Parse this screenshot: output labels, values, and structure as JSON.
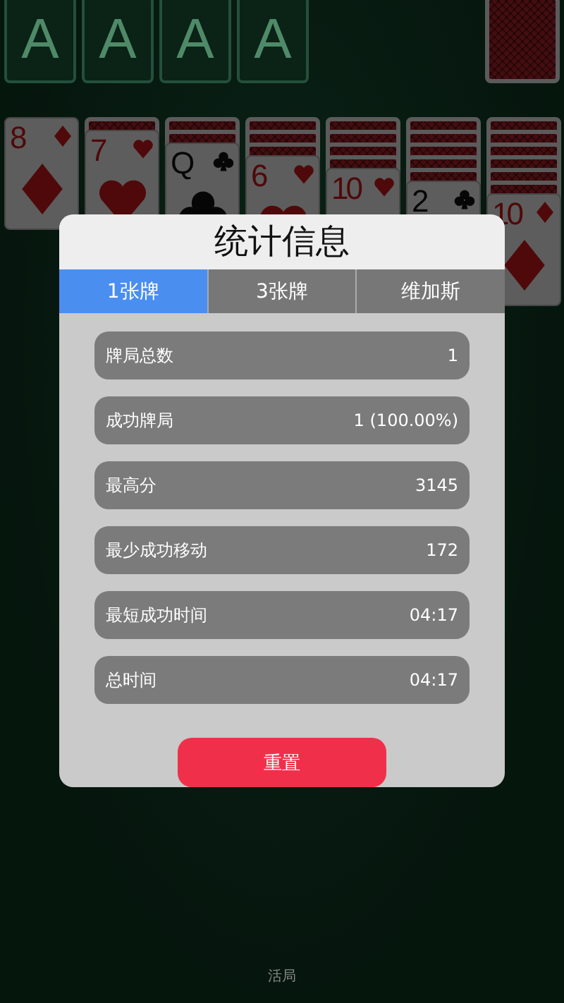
{
  "foundations": [
    {
      "label": "A"
    },
    {
      "label": "A"
    },
    {
      "label": "A"
    },
    {
      "label": "A"
    }
  ],
  "stock": {
    "kind": "card-back"
  },
  "tableau": [
    {
      "cards": [
        {
          "kind": "diamond",
          "rank": "8"
        }
      ]
    },
    {
      "cards": [
        {
          "kind": "back"
        },
        {
          "kind": "heart",
          "rank": "7"
        }
      ]
    },
    {
      "cards": [
        {
          "kind": "back"
        },
        {
          "kind": "back"
        },
        {
          "kind": "club",
          "rank": "Q"
        }
      ]
    },
    {
      "cards": [
        {
          "kind": "back"
        },
        {
          "kind": "back"
        },
        {
          "kind": "back"
        },
        {
          "kind": "heart",
          "rank": "6"
        }
      ]
    },
    {
      "cards": [
        {
          "kind": "back"
        },
        {
          "kind": "back"
        },
        {
          "kind": "back"
        },
        {
          "kind": "back"
        },
        {
          "kind": "heart",
          "rank": "10"
        }
      ]
    },
    {
      "cards": [
        {
          "kind": "back"
        },
        {
          "kind": "back"
        },
        {
          "kind": "back"
        },
        {
          "kind": "back"
        },
        {
          "kind": "back"
        },
        {
          "kind": "club",
          "rank": "2"
        }
      ]
    },
    {
      "cards": [
        {
          "kind": "back"
        },
        {
          "kind": "back"
        },
        {
          "kind": "back"
        },
        {
          "kind": "back"
        },
        {
          "kind": "back"
        },
        {
          "kind": "back"
        },
        {
          "kind": "diamond",
          "rank": "10"
        }
      ]
    }
  ],
  "dialog": {
    "title": "统计信息",
    "tabs": [
      {
        "label": "1张牌",
        "selected": true
      },
      {
        "label": "3张牌",
        "selected": false
      },
      {
        "label": "维加斯",
        "selected": false
      }
    ],
    "stats": [
      {
        "label": "牌局总数",
        "value": "1"
      },
      {
        "label": "成功牌局",
        "value": "1 (100.00%)"
      },
      {
        "label": "最高分",
        "value": "3145"
      },
      {
        "label": "最少成功移动",
        "value": "172"
      },
      {
        "label": "最短成功时间",
        "value": "04:17"
      },
      {
        "label": "总时间",
        "value": "04:17"
      }
    ],
    "reset_button": "重置"
  },
  "bottom_label": "活局"
}
